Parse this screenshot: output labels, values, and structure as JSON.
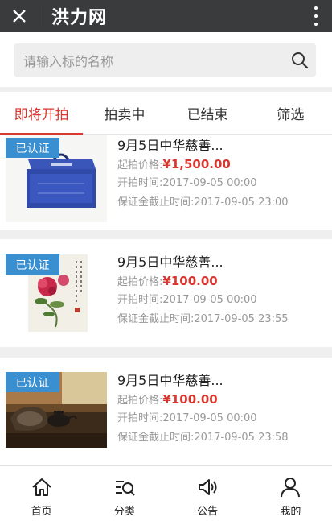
{
  "app": {
    "title": "洪力网"
  },
  "search": {
    "placeholder": "请输入标的名称"
  },
  "tabs": [
    {
      "label": "即将开拍",
      "active": true
    },
    {
      "label": "拍卖中",
      "active": false
    },
    {
      "label": "已结束",
      "active": false
    },
    {
      "label": "筛选",
      "active": false
    }
  ],
  "items": [
    {
      "badge": "已认证",
      "name": "9月5日中华慈善...",
      "price_label": "起拍价格:",
      "price": "¥1,500.00",
      "start_label": "开拍时间:",
      "start_time": "2017-09-05 00:00",
      "deposit_label": "保证金截止时间:",
      "deposit_time": "2017-09-05 23:00"
    },
    {
      "badge": "已认证",
      "name": "9月5日中华慈善...",
      "price_label": "起拍价格:",
      "price": "¥100.00",
      "start_label": "开拍时间:",
      "start_time": "2017-09-05 00:00",
      "deposit_label": "保证金截止时间:",
      "deposit_time": "2017-09-05 23:55"
    },
    {
      "badge": "已认证",
      "name": "9月5日中华慈善...",
      "price_label": "起拍价格:",
      "price": "¥100.00",
      "start_label": "开拍时间:",
      "start_time": "2017-09-05 00:00",
      "deposit_label": "保证金截止时间:",
      "deposit_time": "2017-09-05 23:58"
    }
  ],
  "nav": [
    {
      "label": "首页",
      "icon": "home-icon"
    },
    {
      "label": "分类",
      "icon": "category-search-icon"
    },
    {
      "label": "公告",
      "icon": "speaker-icon"
    },
    {
      "label": "我的",
      "icon": "user-icon"
    }
  ],
  "colors": {
    "accent": "#d9362f",
    "badge": "#3a8fd0",
    "titlebar": "#3a3b3d"
  }
}
